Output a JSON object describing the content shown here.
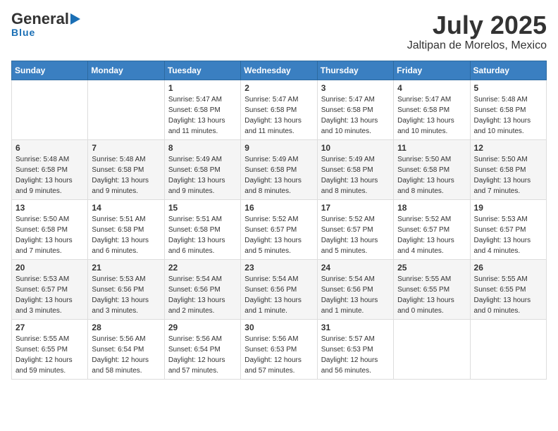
{
  "header": {
    "logo_general": "General",
    "logo_blue": "Blue",
    "month_title": "July 2025",
    "location": "Jaltipan de Morelos, Mexico"
  },
  "columns": [
    "Sunday",
    "Monday",
    "Tuesday",
    "Wednesday",
    "Thursday",
    "Friday",
    "Saturday"
  ],
  "weeks": [
    [
      {
        "day": "",
        "info": ""
      },
      {
        "day": "",
        "info": ""
      },
      {
        "day": "1",
        "info": "Sunrise: 5:47 AM\nSunset: 6:58 PM\nDaylight: 13 hours and 11 minutes."
      },
      {
        "day": "2",
        "info": "Sunrise: 5:47 AM\nSunset: 6:58 PM\nDaylight: 13 hours and 11 minutes."
      },
      {
        "day": "3",
        "info": "Sunrise: 5:47 AM\nSunset: 6:58 PM\nDaylight: 13 hours and 10 minutes."
      },
      {
        "day": "4",
        "info": "Sunrise: 5:47 AM\nSunset: 6:58 PM\nDaylight: 13 hours and 10 minutes."
      },
      {
        "day": "5",
        "info": "Sunrise: 5:48 AM\nSunset: 6:58 PM\nDaylight: 13 hours and 10 minutes."
      }
    ],
    [
      {
        "day": "6",
        "info": "Sunrise: 5:48 AM\nSunset: 6:58 PM\nDaylight: 13 hours and 9 minutes."
      },
      {
        "day": "7",
        "info": "Sunrise: 5:48 AM\nSunset: 6:58 PM\nDaylight: 13 hours and 9 minutes."
      },
      {
        "day": "8",
        "info": "Sunrise: 5:49 AM\nSunset: 6:58 PM\nDaylight: 13 hours and 9 minutes."
      },
      {
        "day": "9",
        "info": "Sunrise: 5:49 AM\nSunset: 6:58 PM\nDaylight: 13 hours and 8 minutes."
      },
      {
        "day": "10",
        "info": "Sunrise: 5:49 AM\nSunset: 6:58 PM\nDaylight: 13 hours and 8 minutes."
      },
      {
        "day": "11",
        "info": "Sunrise: 5:50 AM\nSunset: 6:58 PM\nDaylight: 13 hours and 8 minutes."
      },
      {
        "day": "12",
        "info": "Sunrise: 5:50 AM\nSunset: 6:58 PM\nDaylight: 13 hours and 7 minutes."
      }
    ],
    [
      {
        "day": "13",
        "info": "Sunrise: 5:50 AM\nSunset: 6:58 PM\nDaylight: 13 hours and 7 minutes."
      },
      {
        "day": "14",
        "info": "Sunrise: 5:51 AM\nSunset: 6:58 PM\nDaylight: 13 hours and 6 minutes."
      },
      {
        "day": "15",
        "info": "Sunrise: 5:51 AM\nSunset: 6:58 PM\nDaylight: 13 hours and 6 minutes."
      },
      {
        "day": "16",
        "info": "Sunrise: 5:52 AM\nSunset: 6:57 PM\nDaylight: 13 hours and 5 minutes."
      },
      {
        "day": "17",
        "info": "Sunrise: 5:52 AM\nSunset: 6:57 PM\nDaylight: 13 hours and 5 minutes."
      },
      {
        "day": "18",
        "info": "Sunrise: 5:52 AM\nSunset: 6:57 PM\nDaylight: 13 hours and 4 minutes."
      },
      {
        "day": "19",
        "info": "Sunrise: 5:53 AM\nSunset: 6:57 PM\nDaylight: 13 hours and 4 minutes."
      }
    ],
    [
      {
        "day": "20",
        "info": "Sunrise: 5:53 AM\nSunset: 6:57 PM\nDaylight: 13 hours and 3 minutes."
      },
      {
        "day": "21",
        "info": "Sunrise: 5:53 AM\nSunset: 6:56 PM\nDaylight: 13 hours and 3 minutes."
      },
      {
        "day": "22",
        "info": "Sunrise: 5:54 AM\nSunset: 6:56 PM\nDaylight: 13 hours and 2 minutes."
      },
      {
        "day": "23",
        "info": "Sunrise: 5:54 AM\nSunset: 6:56 PM\nDaylight: 13 hours and 1 minute."
      },
      {
        "day": "24",
        "info": "Sunrise: 5:54 AM\nSunset: 6:56 PM\nDaylight: 13 hours and 1 minute."
      },
      {
        "day": "25",
        "info": "Sunrise: 5:55 AM\nSunset: 6:55 PM\nDaylight: 13 hours and 0 minutes."
      },
      {
        "day": "26",
        "info": "Sunrise: 5:55 AM\nSunset: 6:55 PM\nDaylight: 13 hours and 0 minutes."
      }
    ],
    [
      {
        "day": "27",
        "info": "Sunrise: 5:55 AM\nSunset: 6:55 PM\nDaylight: 12 hours and 59 minutes."
      },
      {
        "day": "28",
        "info": "Sunrise: 5:56 AM\nSunset: 6:54 PM\nDaylight: 12 hours and 58 minutes."
      },
      {
        "day": "29",
        "info": "Sunrise: 5:56 AM\nSunset: 6:54 PM\nDaylight: 12 hours and 57 minutes."
      },
      {
        "day": "30",
        "info": "Sunrise: 5:56 AM\nSunset: 6:53 PM\nDaylight: 12 hours and 57 minutes."
      },
      {
        "day": "31",
        "info": "Sunrise: 5:57 AM\nSunset: 6:53 PM\nDaylight: 12 hours and 56 minutes."
      },
      {
        "day": "",
        "info": ""
      },
      {
        "day": "",
        "info": ""
      }
    ]
  ]
}
